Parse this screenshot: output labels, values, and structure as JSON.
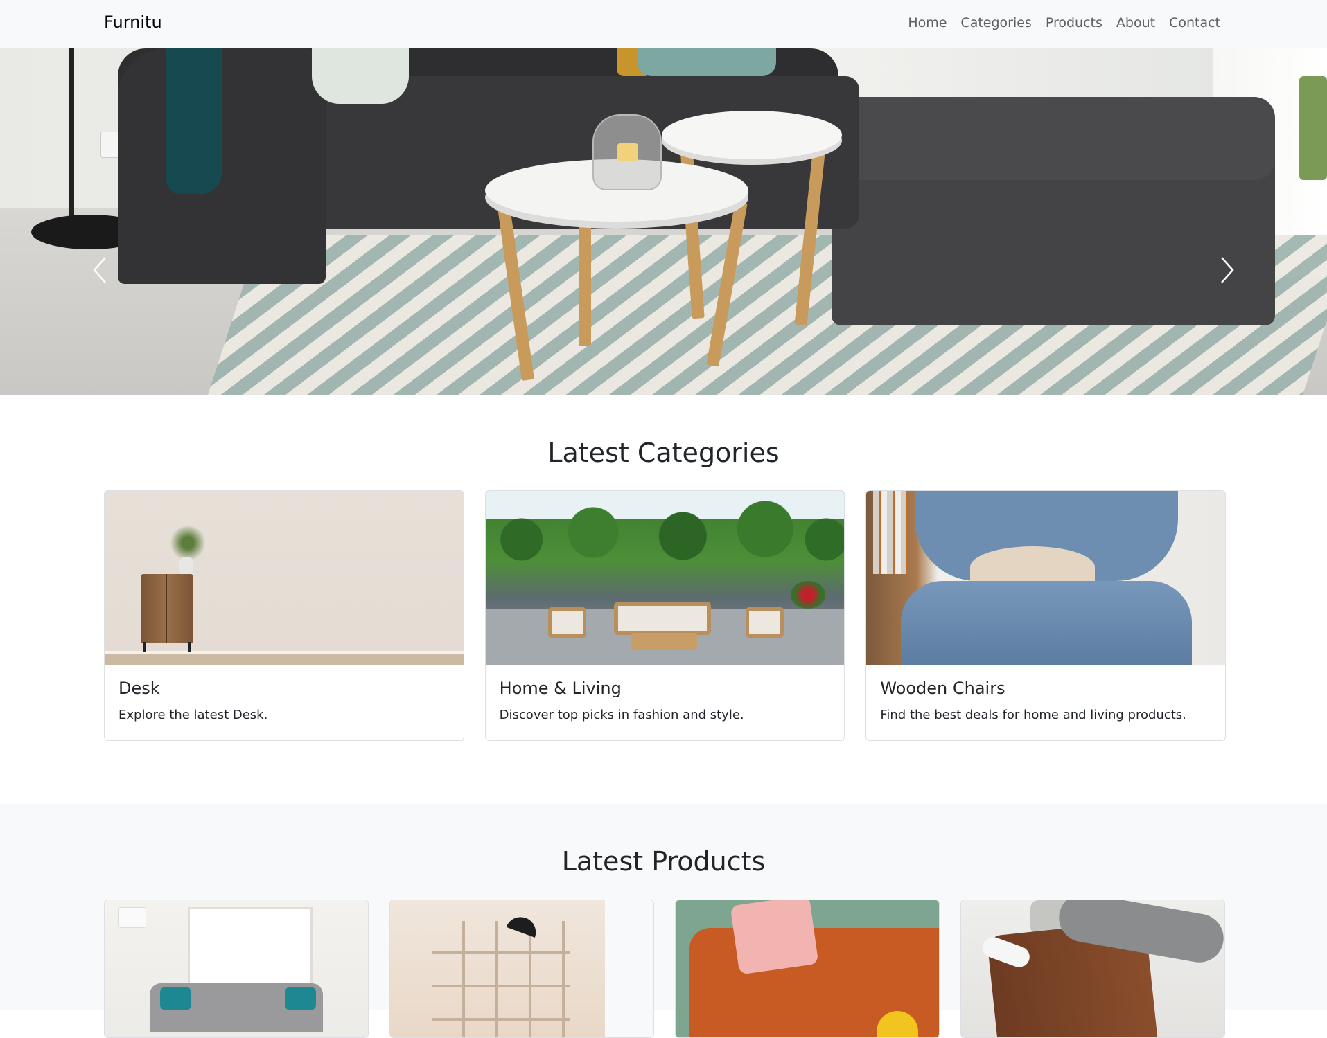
{
  "navbar": {
    "brand": "Furnitu",
    "links": [
      "Home",
      "Categories",
      "Products",
      "About",
      "Contact"
    ]
  },
  "hero": {
    "prev_icon": "chevron-left-icon",
    "next_icon": "chevron-right-icon"
  },
  "categories": {
    "title": "Latest Categories",
    "items": [
      {
        "name": "Desk",
        "description": "Explore the latest Desk."
      },
      {
        "name": "Home & Living",
        "description": "Discover top picks in fashion and style."
      },
      {
        "name": "Wooden Chairs",
        "description": "Find the best deals for home and living products."
      }
    ]
  },
  "products": {
    "title": "Latest Products"
  }
}
